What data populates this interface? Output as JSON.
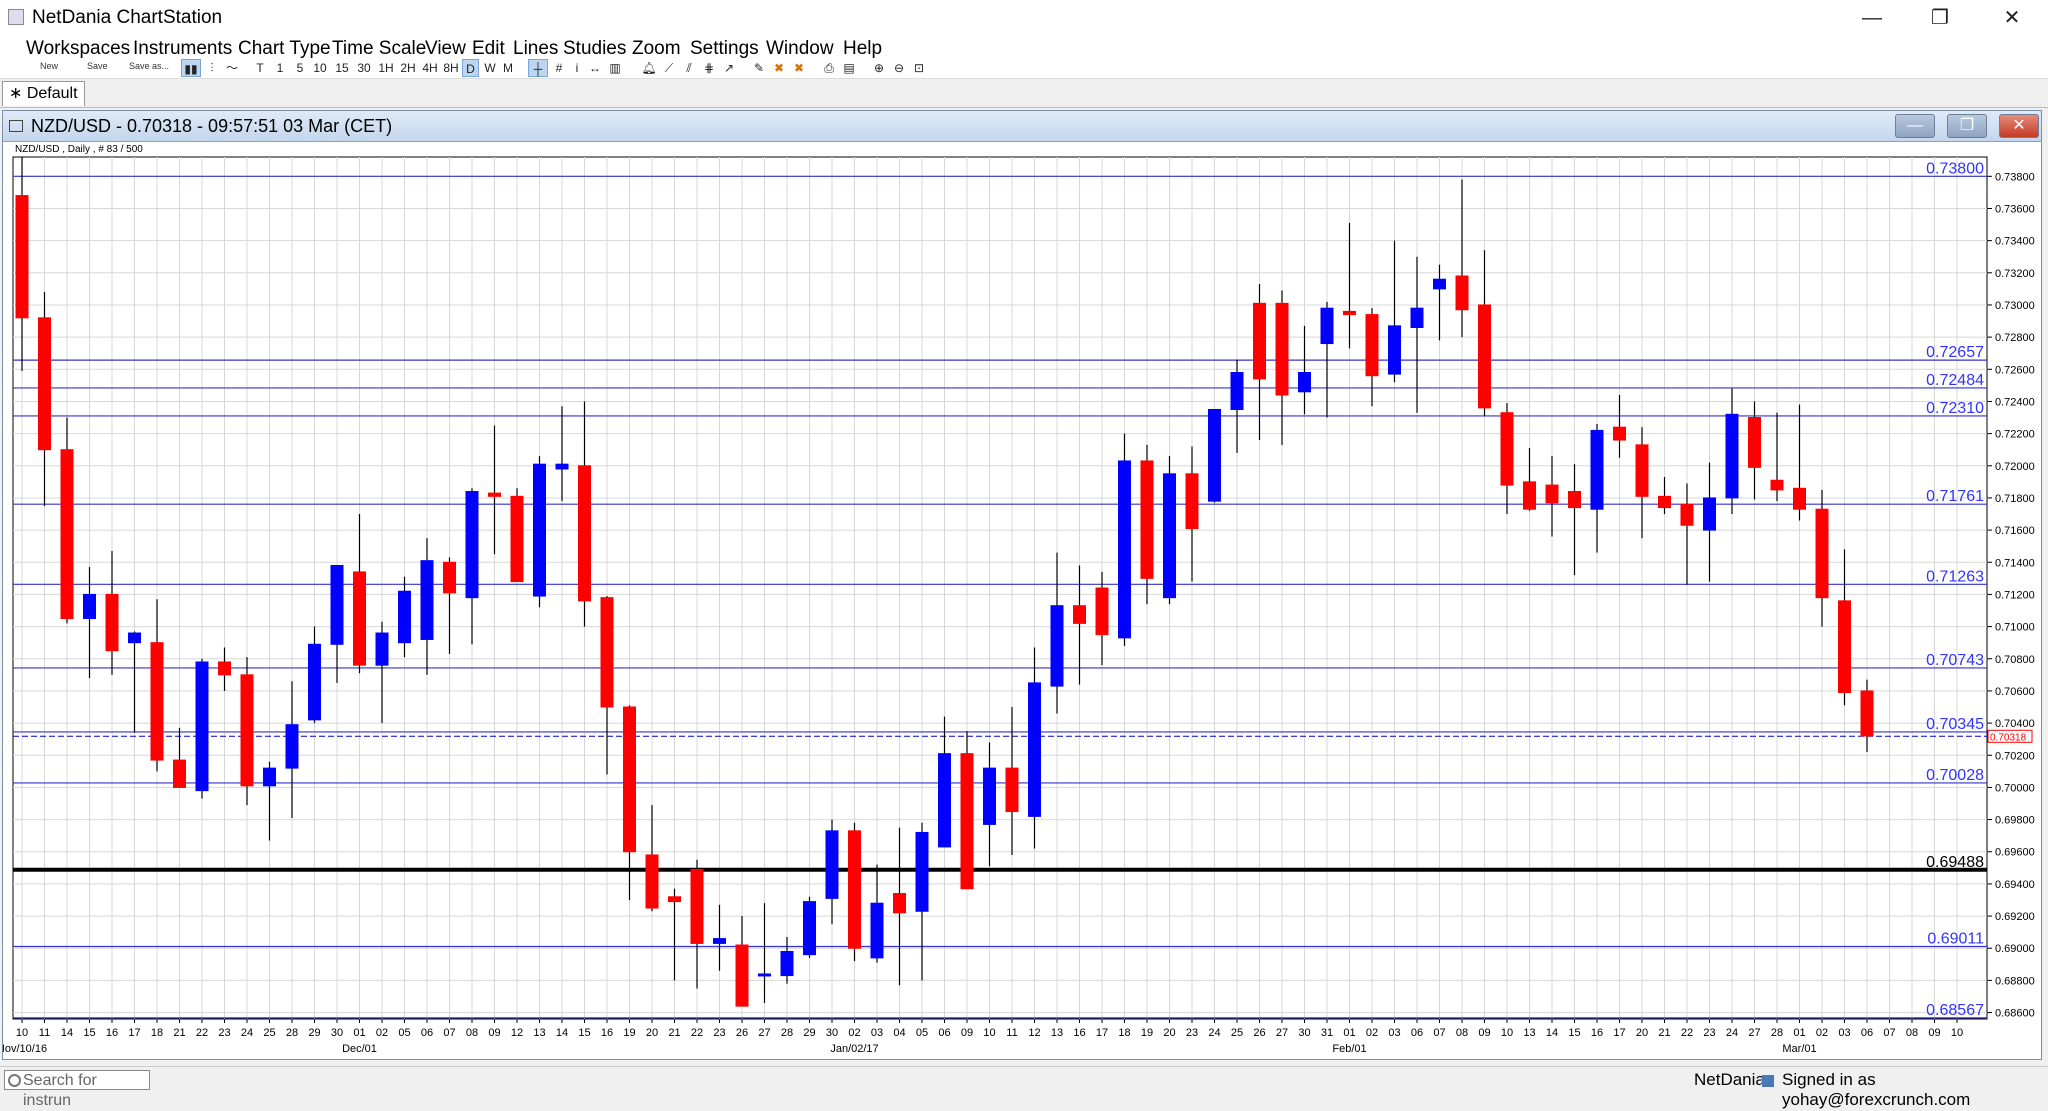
{
  "window": {
    "title": "NetDania ChartStation",
    "minimize": "—",
    "maximize": "❐",
    "close": "✕"
  },
  "menu": [
    "Workspaces",
    "Instruments",
    "Chart Type",
    "Time Scale",
    "View",
    "Edit",
    "Lines",
    "Studies",
    "Zoom",
    "Settings",
    "Window",
    "Help"
  ],
  "toolbar": {
    "new_label": "New",
    "save_label": "Save",
    "saveas_label": "Save as...",
    "timescales": [
      "T",
      "1",
      "5",
      "10",
      "15",
      "30",
      "1H",
      "2H",
      "4H",
      "8H",
      "D",
      "W",
      "M"
    ],
    "active_timescale": "D"
  },
  "workspace_tab": "∗ Default",
  "chart": {
    "title": "NZD/USD - 0.70318 - 09:57:51  03 Mar (CET)",
    "info": "NZD/USD , Daily , # 83 / 500",
    "buttons": {
      "minimize": "—",
      "restore": "❐",
      "close": "✕"
    }
  },
  "colors": {
    "up": "#0000ff",
    "down": "#ff0000",
    "hline": "#3333cc",
    "strong": "#000000",
    "grid": "#d8d8d8"
  },
  "chart_data": {
    "type": "candlestick",
    "ylim": [
      0.6856,
      0.7392
    ],
    "yticks": [
      0.686,
      0.688,
      0.69,
      0.692,
      0.694,
      0.696,
      0.698,
      0.7,
      0.702,
      0.704,
      0.706,
      0.708,
      0.71,
      0.712,
      0.714,
      0.716,
      0.718,
      0.72,
      0.722,
      0.724,
      0.726,
      0.728,
      0.73,
      0.732,
      0.734,
      0.736,
      0.738
    ],
    "day_labels": [
      "10",
      "11",
      "14",
      "15",
      "16",
      "17",
      "18",
      "21",
      "22",
      "23",
      "24",
      "25",
      "28",
      "29",
      "30",
      "01",
      "02",
      "05",
      "06",
      "07",
      "08",
      "09",
      "12",
      "13",
      "14",
      "15",
      "16",
      "19",
      "20",
      "21",
      "22",
      "23",
      "26",
      "27",
      "28",
      "29",
      "30",
      "02",
      "03",
      "04",
      "05",
      "06",
      "09",
      "10",
      "11",
      "12",
      "13",
      "16",
      "17",
      "18",
      "19",
      "20",
      "23",
      "24",
      "25",
      "26",
      "27",
      "30",
      "31",
      "01",
      "02",
      "03",
      "06",
      "07",
      "08",
      "09",
      "10",
      "13",
      "14",
      "15",
      "16",
      "17",
      "20",
      "21",
      "22",
      "23",
      "24",
      "27",
      "28",
      "01",
      "02",
      "03",
      "06",
      "07",
      "08",
      "09",
      "10"
    ],
    "month_labels": [
      {
        "index": 0,
        "label": "Nov/10/16"
      },
      {
        "index": 15,
        "label": "Dec/01"
      },
      {
        "index": 37,
        "label": "Jan/02/17"
      },
      {
        "index": 59,
        "label": "Feb/01"
      },
      {
        "index": 79,
        "label": "Mar/01"
      }
    ],
    "hlines": [
      0.738,
      0.72657,
      0.72484,
      0.7231,
      0.71761,
      0.71263,
      0.70743,
      0.70345,
      0.70028,
      0.69488,
      0.69011,
      0.68567
    ],
    "strong_line": 0.69488,
    "current_price": 0.70318,
    "candles": [
      [
        0.7368,
        0.7392,
        0.7259,
        0.7292
      ],
      [
        0.7292,
        0.7308,
        0.7175,
        0.721
      ],
      [
        0.721,
        0.723,
        0.7102,
        0.7105
      ],
      [
        0.7105,
        0.7137,
        0.7068,
        0.712
      ],
      [
        0.712,
        0.7147,
        0.707,
        0.7085
      ],
      [
        0.709,
        0.7097,
        0.7034,
        0.7096
      ],
      [
        0.709,
        0.7117,
        0.701,
        0.7017
      ],
      [
        0.7017,
        0.7037,
        0.7,
        0.7
      ],
      [
        0.6998,
        0.708,
        0.6993,
        0.7078
      ],
      [
        0.7078,
        0.7087,
        0.706,
        0.707
      ],
      [
        0.707,
        0.7081,
        0.6989,
        0.7001
      ],
      [
        0.7001,
        0.7016,
        0.6967,
        0.7012
      ],
      [
        0.7012,
        0.7066,
        0.6981,
        0.7039
      ],
      [
        0.7042,
        0.71,
        0.704,
        0.7089
      ],
      [
        0.7089,
        0.7138,
        0.7065,
        0.7138
      ],
      [
        0.7134,
        0.717,
        0.7071,
        0.7076
      ],
      [
        0.7076,
        0.7103,
        0.704,
        0.7096
      ],
      [
        0.709,
        0.7131,
        0.7081,
        0.7122
      ],
      [
        0.7092,
        0.7155,
        0.707,
        0.7141
      ],
      [
        0.714,
        0.7143,
        0.7083,
        0.7121
      ],
      [
        0.7118,
        0.7186,
        0.7089,
        0.7184
      ],
      [
        0.7183,
        0.7225,
        0.7145,
        0.7181
      ],
      [
        0.7181,
        0.7186,
        0.7129,
        0.7128
      ],
      [
        0.7119,
        0.7206,
        0.7112,
        0.7201
      ],
      [
        0.7198,
        0.7237,
        0.7178,
        0.7201
      ],
      [
        0.72,
        0.724,
        0.71,
        0.7116
      ],
      [
        0.7118,
        0.7119,
        0.7008,
        0.705
      ],
      [
        0.705,
        0.7051,
        0.693,
        0.696
      ],
      [
        0.6958,
        0.6989,
        0.6923,
        0.6925
      ],
      [
        0.6932,
        0.6937,
        0.688,
        0.6929
      ],
      [
        0.6949,
        0.6955,
        0.6875,
        0.6903
      ],
      [
        0.6903,
        0.6927,
        0.6886,
        0.6906
      ],
      [
        0.6902,
        0.692,
        0.6864,
        0.6864
      ],
      [
        0.6883,
        0.6928,
        0.6866,
        0.6884
      ],
      [
        0.6883,
        0.6907,
        0.6878,
        0.6898
      ],
      [
        0.6896,
        0.6932,
        0.6894,
        0.6929
      ],
      [
        0.6931,
        0.698,
        0.6915,
        0.6973
      ],
      [
        0.6973,
        0.6978,
        0.6892,
        0.69
      ],
      [
        0.6894,
        0.6952,
        0.6891,
        0.6928
      ],
      [
        0.6934,
        0.6975,
        0.6877,
        0.6922
      ],
      [
        0.6923,
        0.6978,
        0.688,
        0.6972
      ],
      [
        0.6963,
        0.7044,
        0.6964,
        0.7021
      ],
      [
        0.7021,
        0.7035,
        0.694,
        0.6937
      ],
      [
        0.6977,
        0.7028,
        0.6951,
        0.7012
      ],
      [
        0.7012,
        0.705,
        0.6958,
        0.6985
      ],
      [
        0.6982,
        0.7087,
        0.6962,
        0.7065
      ],
      [
        0.7063,
        0.7146,
        0.7046,
        0.7113
      ],
      [
        0.7113,
        0.7138,
        0.7064,
        0.7102
      ],
      [
        0.7124,
        0.7134,
        0.7076,
        0.7095
      ],
      [
        0.7093,
        0.722,
        0.7088,
        0.7203
      ],
      [
        0.7203,
        0.7213,
        0.7114,
        0.713
      ],
      [
        0.7118,
        0.7206,
        0.7114,
        0.7195
      ],
      [
        0.7195,
        0.7212,
        0.7128,
        0.7161
      ],
      [
        0.7178,
        0.7234,
        0.7177,
        0.7235
      ],
      [
        0.7235,
        0.7266,
        0.7208,
        0.7258
      ],
      [
        0.7301,
        0.7313,
        0.7216,
        0.7254
      ],
      [
        0.7301,
        0.7309,
        0.7213,
        0.7244
      ],
      [
        0.7246,
        0.7287,
        0.7232,
        0.7258
      ],
      [
        0.7276,
        0.7302,
        0.723,
        0.7298
      ],
      [
        0.7296,
        0.7351,
        0.7273,
        0.7294
      ],
      [
        0.7294,
        0.7298,
        0.7237,
        0.7256
      ],
      [
        0.7257,
        0.734,
        0.7252,
        0.7287
      ],
      [
        0.7286,
        0.733,
        0.7233,
        0.7298
      ],
      [
        0.731,
        0.7325,
        0.7278,
        0.7316
      ],
      [
        0.7318,
        0.7378,
        0.728,
        0.7297
      ],
      [
        0.73,
        0.7334,
        0.7231,
        0.7236
      ],
      [
        0.7233,
        0.7239,
        0.717,
        0.7188
      ],
      [
        0.719,
        0.7211,
        0.7172,
        0.7173
      ],
      [
        0.7188,
        0.7206,
        0.7156,
        0.7177
      ],
      [
        0.7184,
        0.7201,
        0.7132,
        0.7174
      ],
      [
        0.7173,
        0.7226,
        0.7146,
        0.7222
      ],
      [
        0.7224,
        0.7244,
        0.7205,
        0.7216
      ],
      [
        0.7213,
        0.7224,
        0.7155,
        0.7181
      ],
      [
        0.7181,
        0.7193,
        0.717,
        0.7174
      ],
      [
        0.7176,
        0.7189,
        0.7126,
        0.7163
      ],
      [
        0.716,
        0.7202,
        0.7128,
        0.718
      ],
      [
        0.718,
        0.7248,
        0.717,
        0.7232
      ],
      [
        0.723,
        0.724,
        0.7179,
        0.7199
      ],
      [
        0.7191,
        0.7233,
        0.7178,
        0.7185
      ],
      [
        0.7186,
        0.7238,
        0.7166,
        0.7173
      ],
      [
        0.7173,
        0.7185,
        0.71,
        0.7118
      ],
      [
        0.7116,
        0.7148,
        0.7051,
        0.7059
      ],
      [
        0.706,
        0.7067,
        0.7022,
        0.7032
      ]
    ]
  },
  "status": {
    "search_placeholder": "Search for instrun",
    "brand": "NetDania",
    "signed_in": "Signed in as yohay@forexcrunch.com"
  }
}
